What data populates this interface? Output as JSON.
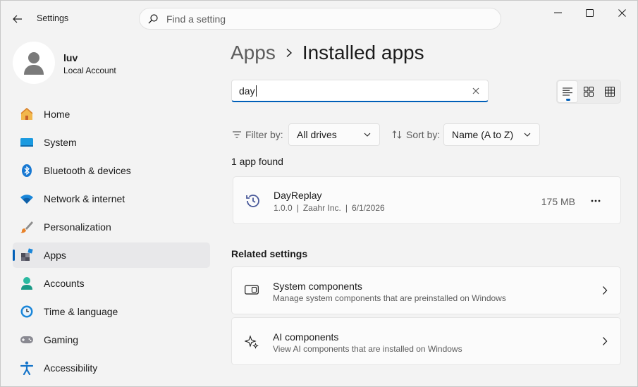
{
  "window": {
    "title": "Settings",
    "search_placeholder": "Find a setting"
  },
  "profile": {
    "name": "luv",
    "account_type": "Local Account"
  },
  "sidebar": {
    "items": [
      {
        "label": "Home",
        "icon": "home-icon"
      },
      {
        "label": "System",
        "icon": "system-icon"
      },
      {
        "label": "Bluetooth & devices",
        "icon": "bluetooth-icon"
      },
      {
        "label": "Network & internet",
        "icon": "wifi-icon"
      },
      {
        "label": "Personalization",
        "icon": "brush-icon"
      },
      {
        "label": "Apps",
        "icon": "apps-icon",
        "active": true
      },
      {
        "label": "Accounts",
        "icon": "accounts-icon"
      },
      {
        "label": "Time & language",
        "icon": "time-language-icon"
      },
      {
        "label": "Gaming",
        "icon": "gaming-icon"
      },
      {
        "label": "Accessibility",
        "icon": "accessibility-icon"
      }
    ]
  },
  "breadcrumb": {
    "parent": "Apps",
    "current": "Installed apps"
  },
  "app_search": {
    "value": "day"
  },
  "filters": {
    "filter_label": "Filter by:",
    "filter_value": "All drives",
    "sort_label": "Sort by:",
    "sort_value": "Name (A to Z)"
  },
  "results": {
    "count_text": "1 app found",
    "apps": [
      {
        "name": "DayReplay",
        "version": "1.0.0",
        "publisher": "Zaahr Inc.",
        "date": "6/1/2026",
        "size": "175 MB"
      }
    ]
  },
  "related": {
    "title": "Related settings",
    "items": [
      {
        "title": "System components",
        "description": "Manage system components that are preinstalled on Windows"
      },
      {
        "title": "AI components",
        "description": "View AI components that are installed on Windows"
      }
    ]
  },
  "colors": {
    "accent": "#005fb8",
    "background": "#f3f3f3",
    "card": "#fbfbfb"
  }
}
